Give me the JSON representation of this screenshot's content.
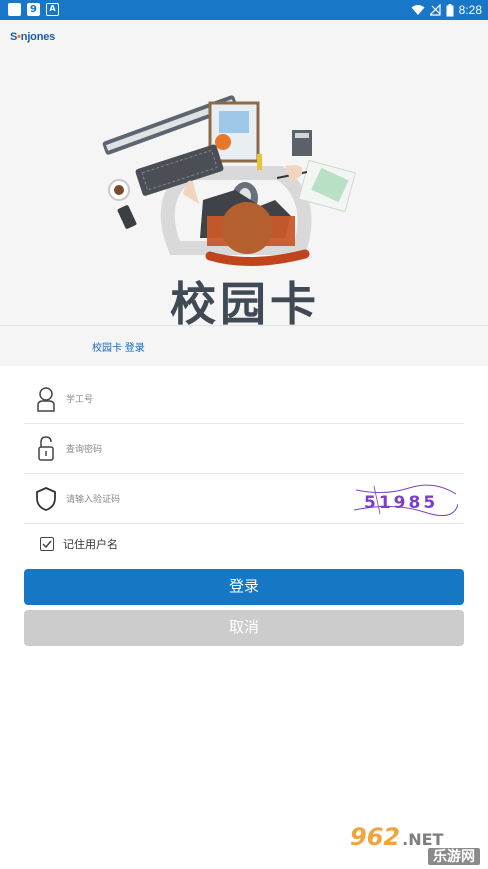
{
  "status_bar": {
    "time": "8:28",
    "left_icons": [
      "app-square-icon",
      "app-9-icon",
      "app-a-icon"
    ],
    "right_icons": [
      "wifi-icon",
      "signal-off-icon",
      "battery-icon"
    ]
  },
  "brand": {
    "prefix": "S",
    "accent": "•",
    "rest": "njones"
  },
  "hero": {
    "illustration_title": "校园卡",
    "section_title": "校园卡 登录"
  },
  "form": {
    "username_placeholder": "学工号",
    "password_placeholder": "查询密码",
    "captcha_placeholder": "请输入验证码",
    "captcha_text": "51985"
  },
  "remember": {
    "label": "记住用户名",
    "checked": true
  },
  "buttons": {
    "login": "登录",
    "cancel": "取消"
  },
  "watermark": {
    "number": "962",
    "suffix": ".NET",
    "site_name": "乐游网"
  },
  "colors": {
    "primary": "#1677c4",
    "status_bar": "#1877c9",
    "cancel": "#cccccc",
    "captcha": "#7b3fc9"
  }
}
